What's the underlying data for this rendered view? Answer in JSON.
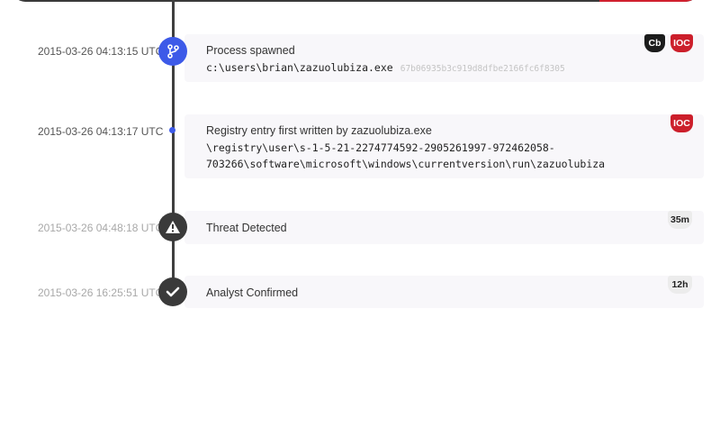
{
  "events": [
    {
      "timestamp": "2015-03-26 04:13:15 UTC",
      "title": "Process spawned",
      "path": "c:\\users\\brian\\zazuolubiza.exe",
      "hash": "67b06935b3c919d8dfbe2166fc6f8305",
      "icon": "branch-icon",
      "badges": [
        "Cb",
        "IOC"
      ]
    },
    {
      "timestamp": "2015-03-26 04:13:17 UTC",
      "title": "Registry entry first written by zazuolubiza.exe",
      "path_line1": "\\registry\\user\\s-1-5-21-2274774592-2905261997-972462058-",
      "path_line2": "703266\\software\\microsoft\\windows\\currentversion\\run\\zazuolubiza",
      "badges": [
        "IOC"
      ]
    },
    {
      "timestamp": "2015-03-26 04:48:18 UTC",
      "title": "Threat Detected",
      "icon": "warning-icon",
      "duration": "35m"
    },
    {
      "timestamp": "2015-03-26 16:25:51 UTC",
      "title": "Analyst Confirmed",
      "icon": "check-icon",
      "duration": "12h"
    }
  ],
  "colors": {
    "accent": "#3d5ae8",
    "ioc": "#cc1f2b",
    "dark": "#3a3a3a"
  }
}
